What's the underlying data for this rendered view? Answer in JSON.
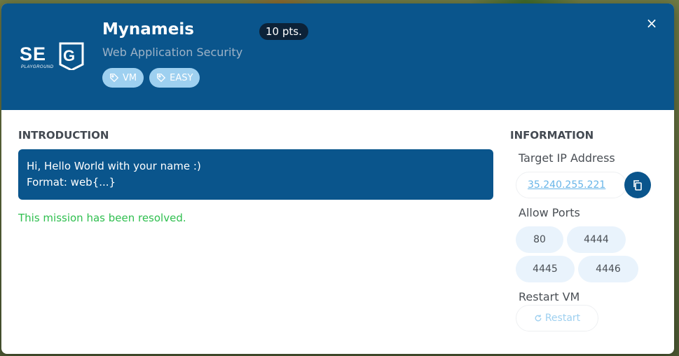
{
  "challenge": {
    "title": "Mynameis",
    "points": "10 pts.",
    "category": "Web Application Security",
    "tags": [
      {
        "label": "VM",
        "icon": "tag-icon"
      },
      {
        "label": "EASY",
        "icon": "tag-icon"
      }
    ],
    "logo": {
      "text": "SEG",
      "subtext": "PLAYGROUND"
    },
    "close_icon": "×"
  },
  "introduction": {
    "heading": "INTRODUCTION",
    "lines": [
      "Hi, Hello World with your name :)",
      "Format: web{...}"
    ],
    "status": "This mission has been resolved."
  },
  "information": {
    "heading": "INFORMATION",
    "target_ip_label": "Target IP Address",
    "target_ip": "35.240.255.221",
    "allow_ports_label": "Allow Ports",
    "ports": [
      "80",
      "4444",
      "4445",
      "4446"
    ],
    "restart_label": "Restart VM",
    "restart_button": "Restart"
  },
  "colors": {
    "header": "#0a558c",
    "tag": "#9ed0f0",
    "success": "#2fbf4f",
    "port_bg": "#e9f3fc"
  }
}
